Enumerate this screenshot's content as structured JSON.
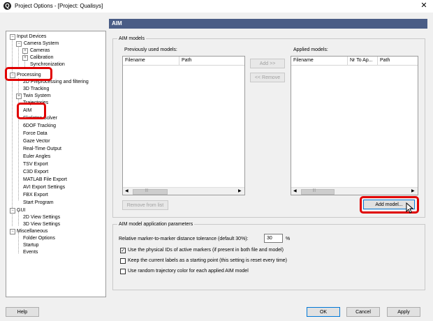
{
  "window": {
    "title": "Project Options - [Project: Qualisys]",
    "close_glyph": "✕",
    "app_icon_glyph": "Q"
  },
  "tree": {
    "input_devices": "Input Devices",
    "camera_system": "Camera System",
    "cameras": "Cameras",
    "calibration": "Calibration",
    "synchronization": "Synchronization",
    "processing": "Processing",
    "preprocessing": "2D Preprocessing and filtering",
    "tracking3d": "3D Tracking",
    "twin_system": "Twin System",
    "trajectories": "Trajectories",
    "aim": "AIM",
    "skeleton_solver": "Skeleton Solver",
    "tracking6dof": "6DOF Tracking",
    "force_data": "Force Data",
    "gaze_vector": "Gaze Vector",
    "realtime_output": "Real-Time Output",
    "euler_angles": "Euler Angles",
    "tsv_export": "TSV Export",
    "c3d_export": "C3D Export",
    "matlab_export": "MATLAB File Export",
    "avi_export": "AVI Export Settings",
    "fbx_export": "FBX Export",
    "start_program": "Start Program",
    "gui": "GUI",
    "view2d": "2D View Settings",
    "view3d": "3D View Settings",
    "misc": "Miscellaneous",
    "folder_options": "Folder Options",
    "startup": "Startup",
    "events": "Events",
    "expander_minus": "−",
    "expander_plus": "+"
  },
  "panel": {
    "header": "AIM"
  },
  "aim_models": {
    "legend": "AIM models",
    "prev_label": "Previously used models:",
    "applied_label": "Applied models:",
    "prev_columns": [
      "Filename",
      "Path"
    ],
    "applied_columns": [
      "Filename",
      "Nr To Ap...",
      "Path"
    ],
    "add_btn": "Add >>",
    "remove_btn": "<< Remove",
    "remove_from_list_btn": "Remove from list",
    "add_model_btn": "Add model...",
    "scroll_left": "◀",
    "scroll_right": "▶",
    "thumb_grip": "|||"
  },
  "params": {
    "legend": "AIM model application parameters",
    "tolerance_label": "Relative marker-to-marker distance tolerance (default 30%):",
    "tolerance_value": "30",
    "tolerance_unit": "%",
    "opt_physical_ids": "Use the physical IDs of active markers (if present in both file and model)",
    "opt_keep_labels": "Keep the current labels as a starting point (this setting is reset every time)",
    "opt_random_color": "Use random trajectory color for each applied AIM model",
    "checked_glyph": "✓"
  },
  "footer": {
    "help": "Help",
    "ok": "OK",
    "cancel": "Cancel",
    "apply": "Apply"
  }
}
